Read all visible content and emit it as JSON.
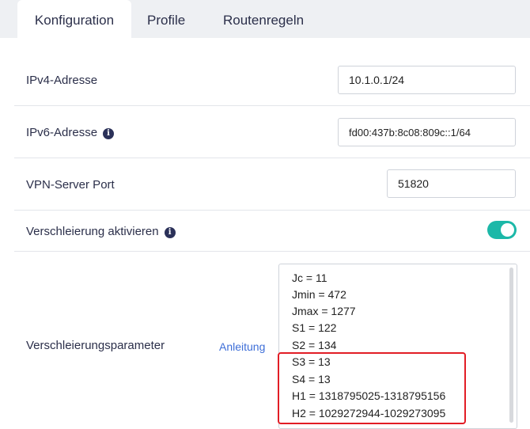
{
  "tabs": [
    {
      "label": "Konfiguration",
      "active": true
    },
    {
      "label": "Profile",
      "active": false
    },
    {
      "label": "Routenregeln",
      "active": false
    }
  ],
  "ipv4": {
    "label": "IPv4-Adresse",
    "value": "10.1.0.1/24"
  },
  "ipv6": {
    "label": "IPv6-Adresse",
    "value": "fd00:437b:8c08:809c::1/64",
    "info_icon": "info-icon"
  },
  "port": {
    "label": "VPN-Server Port",
    "value": "51820"
  },
  "obfuscation": {
    "label": "Verschleierung aktivieren",
    "enabled": true,
    "info_icon": "info-icon"
  },
  "params": {
    "label": "Verschleierungsparameter",
    "guide_link": "Anleitung",
    "lines": [
      "Jc = 11",
      "Jmin = 472",
      "Jmax = 1277",
      "S1 = 122",
      "S2 = 134",
      "S3 = 13",
      "S4 = 13",
      "H1 = 1318795025-1318795156",
      "H2 = 1029272944-1029273095"
    ]
  },
  "colors": {
    "accent_toggle": "#1cb8a8",
    "link": "#3d6ed8",
    "highlight_box": "#e21d25",
    "text": "#2b2f4a"
  }
}
